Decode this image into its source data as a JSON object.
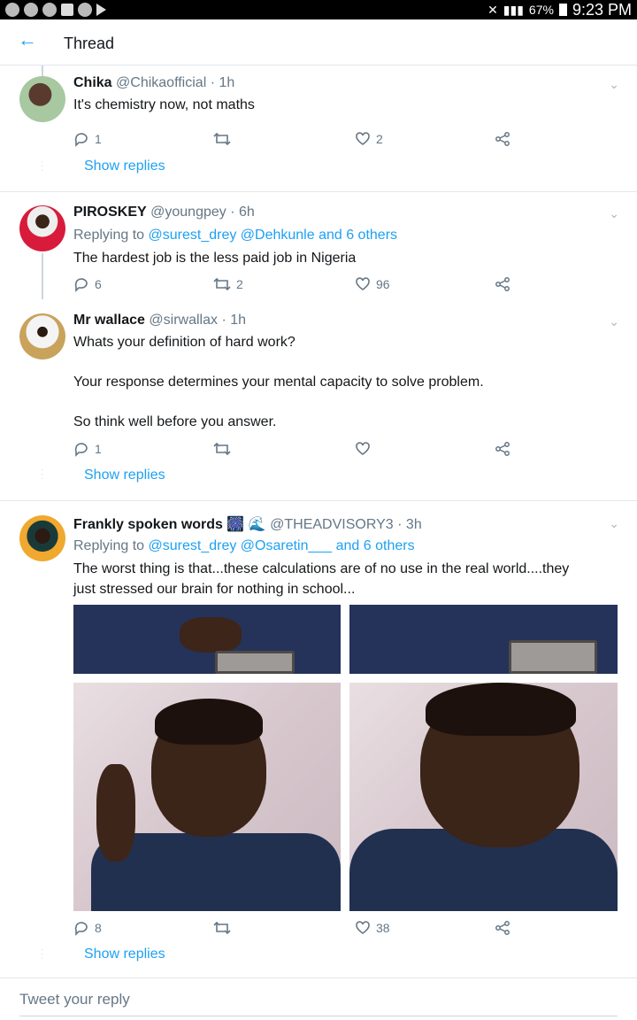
{
  "status_bar": {
    "battery": "67%",
    "time": "9:23 PM"
  },
  "header": {
    "title": "Thread"
  },
  "tweets": [
    {
      "name": "Chika",
      "handle": "@Chikaofficial",
      "time": "· 1h",
      "reply_to": null,
      "text": "It's chemistry now, not maths",
      "replies": "1",
      "retweets": "",
      "likes": "2",
      "show_replies": "Show replies"
    },
    {
      "name": "PIROSKEY",
      "handle": "@youngpey",
      "time": "· 6h",
      "reply_to_prefix": "Replying to",
      "reply_to_links": "@surest_drey @Dehkunle and 6 others",
      "text": "The hardest job is the less paid job in Nigeria",
      "replies": "6",
      "retweets": "2",
      "likes": "96"
    },
    {
      "name": "Mr wallace",
      "handle": "@sirwallax",
      "time": "· 1h",
      "text_lines": [
        "Whats your definition of hard work?",
        "Your response determines your mental capacity to solve problem.",
        "So think well before you answer."
      ],
      "replies": "1",
      "retweets": "",
      "likes": "",
      "show_replies": "Show replies"
    },
    {
      "name": "Frankly spoken words",
      "name_emoji": "🎆 🌊",
      "handle": "@THEADVISORY3",
      "time": "· 3h",
      "reply_to_prefix": "Replying to",
      "reply_to_links": "@surest_drey @Osaretin___ and 6 others",
      "text_lines": [
        "The worst thing is that...these calculations are of no use in the real world....they",
        "just stressed our brain for nothing in school..."
      ],
      "replies": "8",
      "retweets": "",
      "likes": "38",
      "show_replies": "Show replies"
    }
  ],
  "composer": {
    "placeholder": "Tweet your reply"
  },
  "colors": {
    "accent": "#1da1f2",
    "muted": "#657786",
    "divider": "#e1e8ed"
  }
}
